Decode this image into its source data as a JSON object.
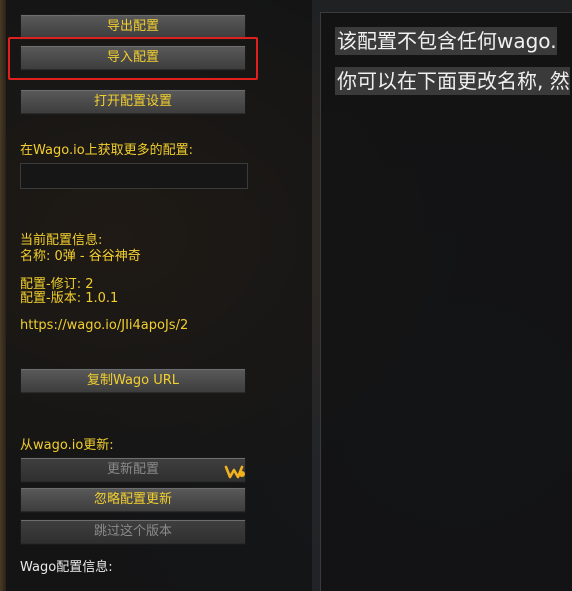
{
  "left": {
    "export_button": "导出配置",
    "import_button": "导入配置",
    "open_settings_button": "打开配置设置",
    "get_more_label": "在Wago.io上获取更多的配置:",
    "current_info_label": "当前配置信息:",
    "name_line": "名称:  0弹 - 谷谷神奇",
    "revision_line": "配置-修订: 2",
    "version_line": "配置-版本: 1.0.1",
    "url": "https://wago.io/JIi4apoJs/2",
    "copy_url_button": "复制Wago URL",
    "update_from_label": "从wago.io更新:",
    "update_button": "更新配置",
    "ignore_update_button": "忽略配置更新",
    "skip_version_button": "跳过这个版本",
    "wago_info_label": "Wago配置信息:"
  },
  "right": {
    "line1": "该配置不包含任何wago.",
    "line2": "你可以在下面更改名称, 然"
  },
  "icons": {
    "wago": "wago-logo-icon"
  },
  "colors": {
    "accent_text": "#f2cf2e",
    "highlight_border": "#e01f1f"
  }
}
